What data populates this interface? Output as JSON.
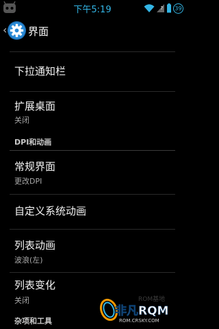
{
  "status_bar": {
    "time": "下午5:19",
    "battery_level": "39"
  },
  "action_bar": {
    "title": "界面"
  },
  "preferences": [
    {
      "title": "下拉通知栏"
    },
    {
      "title": "扩展桌面",
      "summary": "关闭"
    },
    {
      "category": "DPI和动画"
    },
    {
      "title": "常规界面",
      "summary": "更改DPI"
    },
    {
      "title": "自定义系统动画"
    },
    {
      "title": "列表动画",
      "summary": "波浪(左)"
    },
    {
      "title": "列表变化",
      "summary": "关闭"
    },
    {
      "category": "杂项和工具"
    }
  ],
  "watermark": {
    "brand": "非凡RQM",
    "url": "ROM.CRSKY.COM",
    "faint_text": "ROM基地"
  },
  "colors": {
    "accent": "#33b5e5",
    "background": "#000000"
  }
}
